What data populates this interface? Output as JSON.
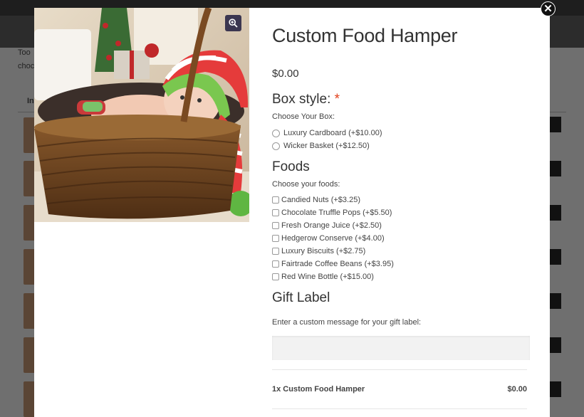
{
  "background": {
    "text_line_1": "Too",
    "text_line_2": "choc",
    "column_label": "In"
  },
  "modal": {
    "close_icon": "close-icon",
    "zoom_icon": "magnify-plus-icon",
    "image_alt": "Baby in a wicker basket wearing a striped knit hat",
    "title": "Custom Food Hamper",
    "price": "$0.00",
    "box_style": {
      "heading": "Box style:",
      "required_mark": "*",
      "sublabel": "Choose Your Box:",
      "options": [
        "Luxury Cardboard (+$10.00)",
        "Wicker Basket (+$12.50)"
      ]
    },
    "foods": {
      "heading": "Foods",
      "sublabel": "Choose your foods:",
      "options": [
        "Candied Nuts (+$3.25)",
        "Chocolate Truffle Pops (+$5.50)",
        "Fresh Orange Juice (+$2.50)",
        "Hedgerow Conserve (+$4.00)",
        "Luxury Biscuits (+$2.75)",
        "Fairtrade Coffee Beans (+$3.95)",
        "Red Wine Bottle (+$15.00)"
      ]
    },
    "gift_label": {
      "heading": "Gift Label",
      "sublabel": "Enter a custom message for your gift label:",
      "value": ""
    },
    "totals": {
      "item": "1x Custom Food Hamper",
      "amount": "$0.00"
    }
  }
}
